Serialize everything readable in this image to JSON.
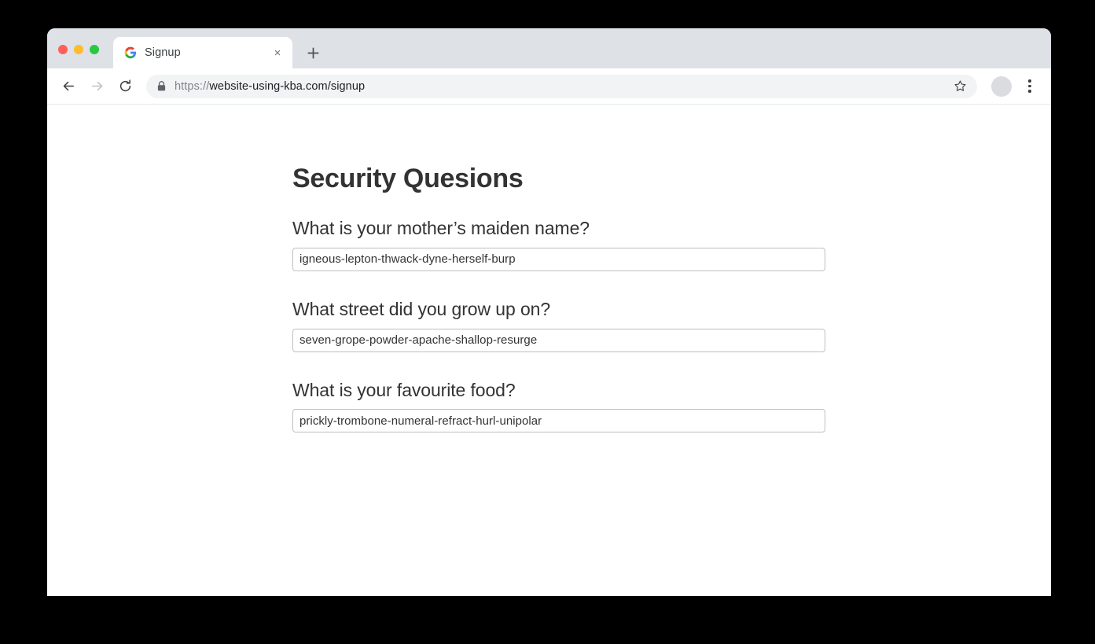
{
  "window": {
    "traffic_lights": [
      {
        "name": "close",
        "color": "#ff5f57"
      },
      {
        "name": "minimize",
        "color": "#febc2e"
      },
      {
        "name": "maximize",
        "color": "#28c840"
      }
    ]
  },
  "tab_strip": {
    "tabs": [
      {
        "title": "Signup",
        "favicon": "google-favicon",
        "close_label": "×",
        "active": true
      }
    ],
    "new_tab_label": "+"
  },
  "toolbar": {
    "back_icon": "back-arrow-icon",
    "forward_icon": "forward-arrow-icon",
    "reload_icon": "reload-icon",
    "security_icon": "lock-icon",
    "url_scheme": "https://",
    "url_rest": "website-using-kba.com/signup",
    "url_full": "https://website-using-kba.com/signup",
    "bookmark_icon": "star-icon",
    "avatar_icon": "profile-avatar",
    "menu_icon": "three-dot-menu-icon"
  },
  "page": {
    "title": "Security Quesions",
    "questions": [
      {
        "label": "What is your mother’s maiden name?",
        "value": "igneous-lepton-thwack-dyne-herself-burp",
        "placeholder": ""
      },
      {
        "label": "What street did you grow up on?",
        "value": "seven-grope-powder-apache-shallop-resurge",
        "placeholder": ""
      },
      {
        "label": "What is your favourite food?",
        "value": "prickly-trombone-numeral-refract-hurl-unipolar",
        "placeholder": ""
      }
    ]
  },
  "colors": {
    "tabbar_background": "#dee1e6",
    "omnibox_background": "#f1f3f4",
    "text_primary": "#333333",
    "input_border": "#bfbfbf",
    "desktop_background": "#000000"
  }
}
